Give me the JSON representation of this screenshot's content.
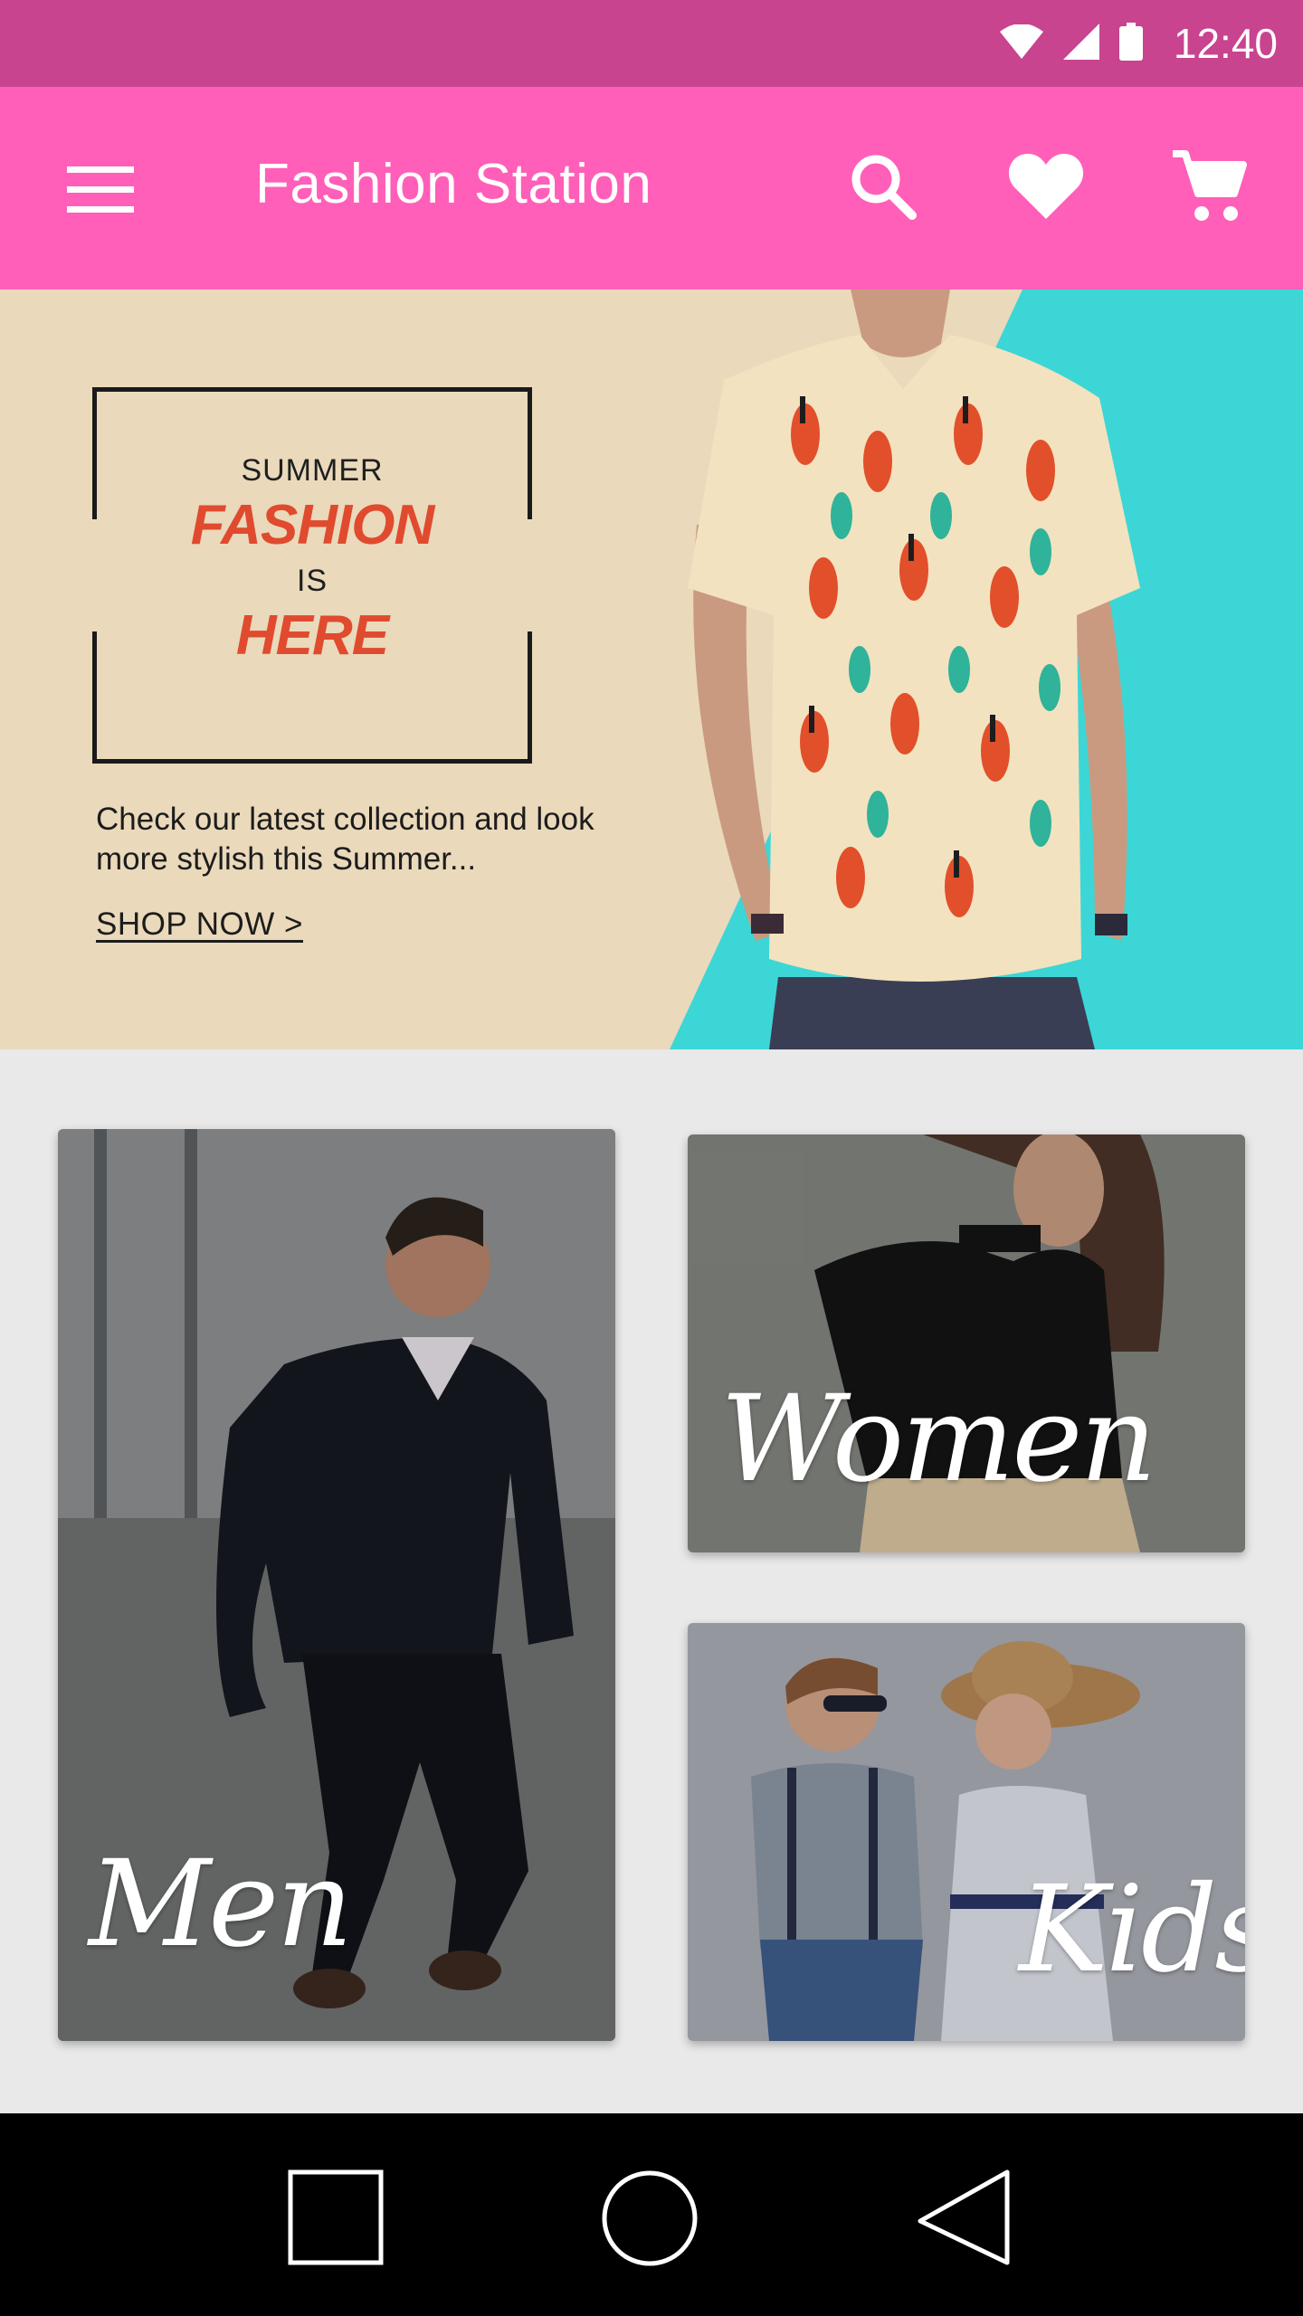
{
  "status_bar": {
    "time": "12:40",
    "icons": [
      "wifi-icon",
      "cell-signal-icon",
      "battery-icon"
    ]
  },
  "app_bar": {
    "title": "Fashion Station",
    "background": "#ff5fb8",
    "actions": [
      "search-icon",
      "heart-icon",
      "cart-icon"
    ]
  },
  "hero": {
    "line1": "SUMMER",
    "line2": "FASHION",
    "line3": "IS",
    "line4": "HERE",
    "copy": "Check our latest collection and look more stylish this Summer...",
    "cta": "SHOP NOW >",
    "accent": "#e04a2e",
    "teal": "#3dd6d6"
  },
  "categories": [
    {
      "label": "Men"
    },
    {
      "label": "Women"
    },
    {
      "label": "Kids"
    }
  ],
  "nav": [
    "recents-icon",
    "home-icon",
    "back-icon"
  ]
}
